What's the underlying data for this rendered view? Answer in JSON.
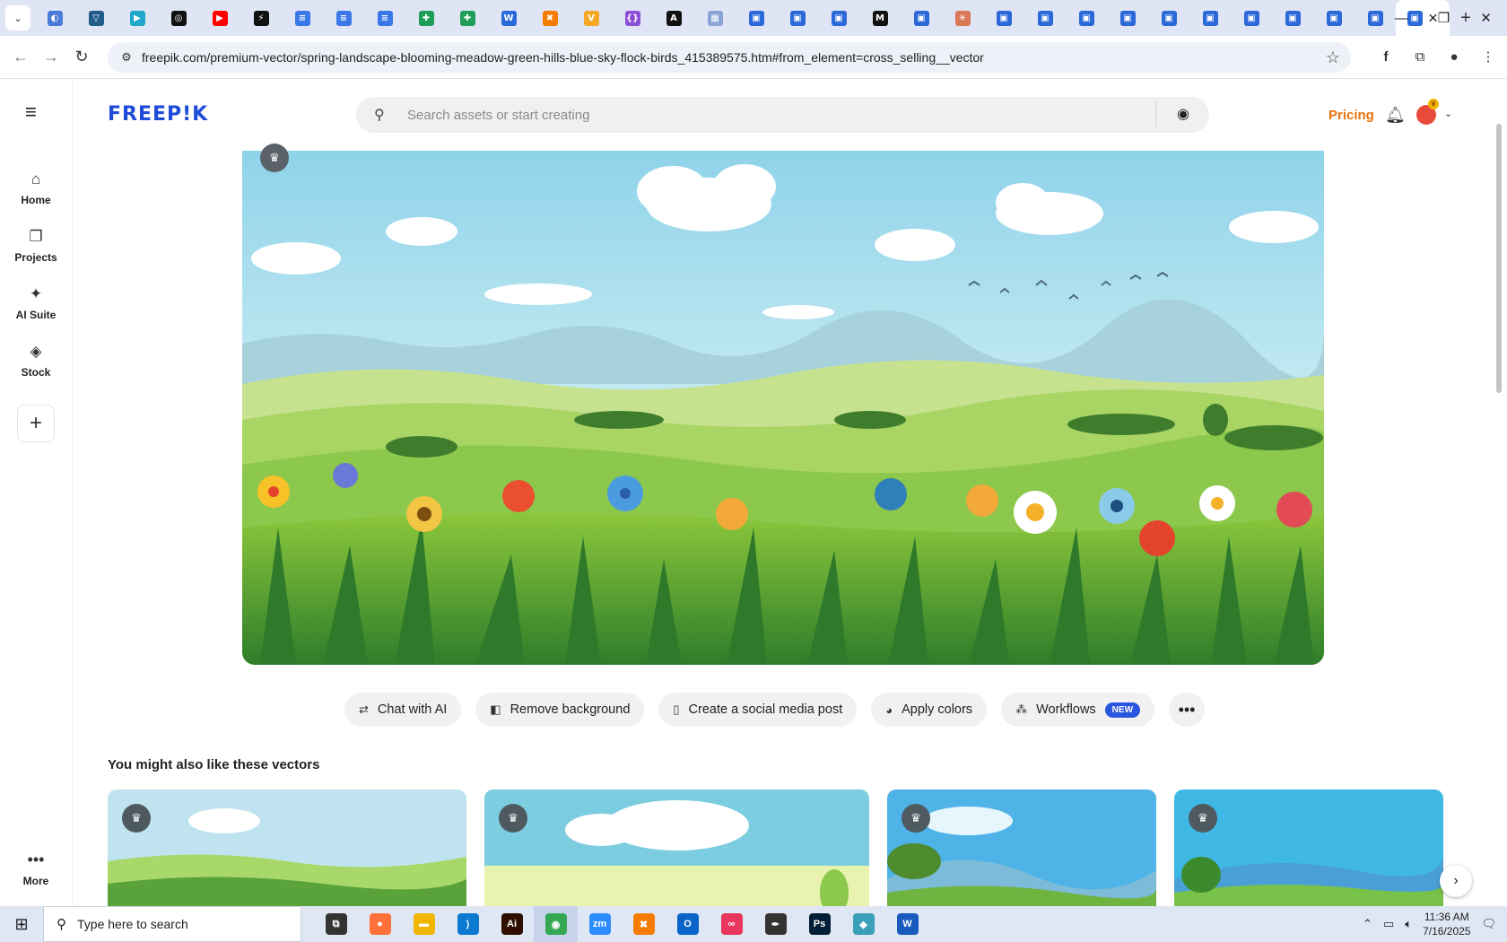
{
  "browser": {
    "tabs": [
      {
        "icon": "globe-icon",
        "color": "#4b7bd8",
        "glyph": "◐"
      },
      {
        "icon": "vpn-icon",
        "color": "#1f5c8a",
        "glyph": "▽"
      },
      {
        "icon": "arrow-app-icon",
        "color": "#1fa7c9",
        "glyph": "▶"
      },
      {
        "icon": "openai-icon",
        "color": "#111111",
        "glyph": "◎"
      },
      {
        "icon": "youtube-icon",
        "color": "#ff0000",
        "glyph": "▶"
      },
      {
        "icon": "bolt-app-icon",
        "color": "#111111",
        "glyph": "⚡"
      },
      {
        "icon": "google-docs-icon",
        "color": "#3b78e7",
        "glyph": "≡"
      },
      {
        "icon": "google-docs-icon",
        "color": "#3b78e7",
        "glyph": "≡"
      },
      {
        "icon": "google-docs-icon",
        "color": "#3b78e7",
        "glyph": "≡"
      },
      {
        "icon": "google-sheets-icon",
        "color": "#1e9e58",
        "glyph": "✚"
      },
      {
        "icon": "google-sheets-icon",
        "color": "#1e9e58",
        "glyph": "✚"
      },
      {
        "icon": "word-online-icon",
        "color": "#2b68d8",
        "glyph": "W"
      },
      {
        "icon": "xampp-icon",
        "color": "#f57c00",
        "glyph": "✖"
      },
      {
        "icon": "vercel-icon",
        "color": "#f5a623",
        "glyph": "V"
      },
      {
        "icon": "json-icon",
        "color": "#8a4fd6",
        "glyph": "{}"
      },
      {
        "icon": "a-app-icon",
        "color": "#111111",
        "glyph": "A"
      },
      {
        "icon": "grid-app-icon",
        "color": "#8aa4d6",
        "glyph": "▦"
      },
      {
        "icon": "forms-icon",
        "color": "#2b68d8",
        "glyph": "▣"
      },
      {
        "icon": "forms-icon",
        "color": "#2b68d8",
        "glyph": "▣"
      },
      {
        "icon": "forms-icon",
        "color": "#2b68d8",
        "glyph": "▣"
      },
      {
        "icon": "medium-icon",
        "color": "#111111",
        "glyph": "M"
      },
      {
        "icon": "forms-icon",
        "color": "#2b68d8",
        "glyph": "▣"
      },
      {
        "icon": "claude-icon",
        "color": "#d97757",
        "glyph": "✳"
      },
      {
        "icon": "forms-icon",
        "color": "#2b68d8",
        "glyph": "▣"
      },
      {
        "icon": "forms-icon",
        "color": "#2b68d8",
        "glyph": "▣"
      },
      {
        "icon": "forms-icon",
        "color": "#2b68d8",
        "glyph": "▣"
      },
      {
        "icon": "forms-icon",
        "color": "#2b68d8",
        "glyph": "▣"
      },
      {
        "icon": "forms-icon",
        "color": "#2b68d8",
        "glyph": "▣"
      },
      {
        "icon": "forms-icon",
        "color": "#2b68d8",
        "glyph": "▣"
      },
      {
        "icon": "forms-icon",
        "color": "#2b68d8",
        "glyph": "▣"
      },
      {
        "icon": "forms-icon",
        "color": "#2b68d8",
        "glyph": "▣"
      },
      {
        "icon": "forms-icon",
        "color": "#2b68d8",
        "glyph": "▣"
      },
      {
        "icon": "forms-icon",
        "color": "#2b68d8",
        "glyph": "▣"
      }
    ],
    "active_tab_icon": "forms-icon",
    "url": "freepik.com/premium-vector/spring-landscape-blooming-meadow-green-hills-blue-sky-flock-birds_415389575.htm#from_element=cross_selling__vector"
  },
  "rail": {
    "items": [
      {
        "label": "Home",
        "icon": "⌂"
      },
      {
        "label": "Projects",
        "icon": "❐"
      },
      {
        "label": "AI Suite",
        "icon": "✦"
      },
      {
        "label": "Stock",
        "icon": "◈"
      }
    ],
    "plus": "+",
    "more_label": "More"
  },
  "header": {
    "logo": "FREEP!K",
    "search_placeholder": "Search assets or start creating",
    "pricing": "Pricing"
  },
  "actions": {
    "chips": [
      {
        "label": "Chat with AI",
        "icon": "⇄"
      },
      {
        "label": "Remove background",
        "icon": "◧"
      },
      {
        "label": "Create a social media post",
        "icon": "▯"
      },
      {
        "label": "Apply colors",
        "icon": "◕"
      },
      {
        "label": "Workflows",
        "icon": "⁂",
        "badge": "NEW"
      }
    ]
  },
  "related": {
    "title": "You might also like these vectors"
  },
  "taskbar": {
    "search_placeholder": "Type here to search",
    "time": "11:36 AM",
    "date": "7/16/2025",
    "apps": [
      {
        "icon": "task-view-icon",
        "color": "#333333",
        "glyph": "⧉"
      },
      {
        "icon": "firefox-icon",
        "color": "#ff7139",
        "glyph": "●"
      },
      {
        "icon": "file-explorer-icon",
        "color": "#f2b600",
        "glyph": "▬"
      },
      {
        "icon": "vscode-icon",
        "color": "#0a7ad1",
        "glyph": "⟩"
      },
      {
        "icon": "illustrator-icon",
        "color": "#2f0e00",
        "glyph": "Ai"
      },
      {
        "icon": "chrome-icon",
        "color": "#34a853",
        "glyph": "◉"
      },
      {
        "icon": "zoom-icon",
        "color": "#2d8cff",
        "glyph": "zm"
      },
      {
        "icon": "xampp-icon",
        "color": "#f57c00",
        "glyph": "✖"
      },
      {
        "icon": "outlook-icon",
        "color": "#0a64c8",
        "glyph": "O"
      },
      {
        "icon": "creative-cloud-icon",
        "color": "#e9365c",
        "glyph": "∞"
      },
      {
        "icon": "pen-tool-icon",
        "color": "#333333",
        "glyph": "✒"
      },
      {
        "icon": "photoshop-icon",
        "color": "#001e36",
        "glyph": "Ps"
      },
      {
        "icon": "gem-app-icon",
        "color": "#3aa0b8",
        "glyph": "◆"
      },
      {
        "icon": "word-icon",
        "color": "#185abd",
        "glyph": "W"
      }
    ],
    "active_app": "chrome-icon"
  }
}
